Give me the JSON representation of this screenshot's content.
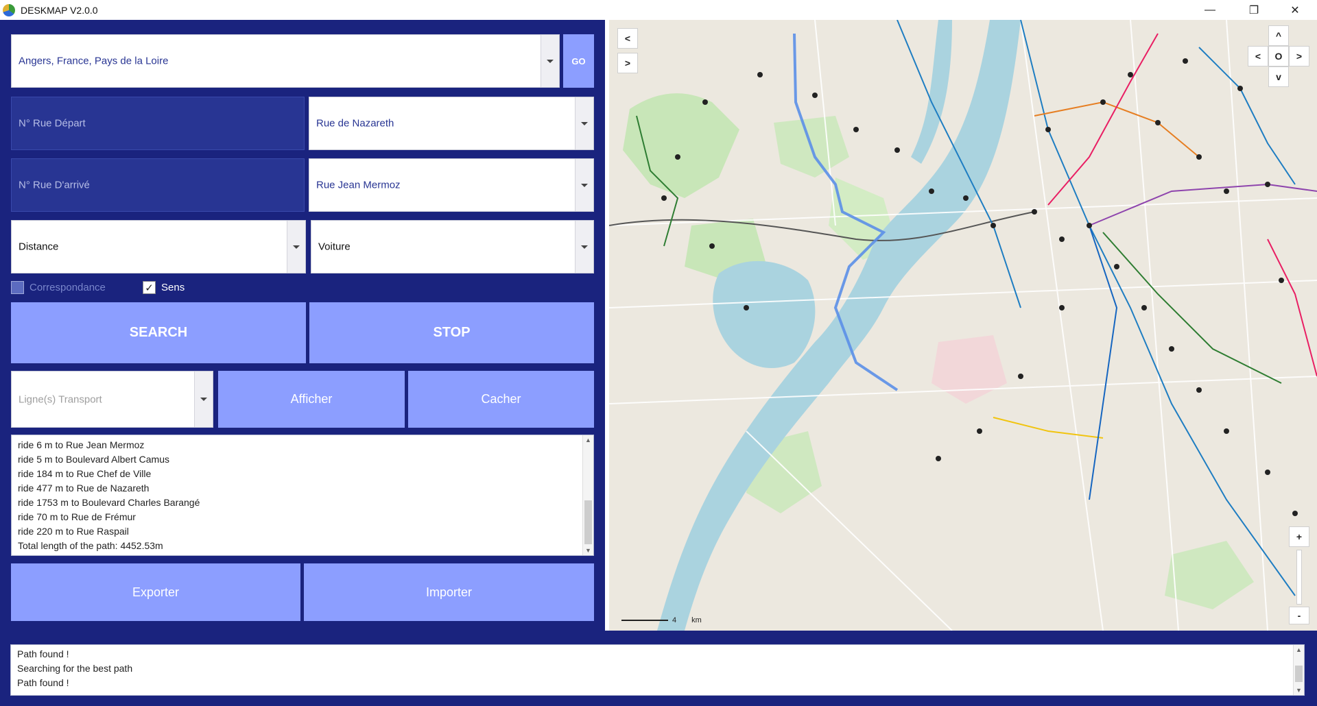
{
  "window": {
    "title": "DESKMAP V2.0.0",
    "minimize_icon": "—",
    "restore_icon": "❐",
    "close_icon": "✕"
  },
  "city_select": {
    "value": "Angers, France, Pays de la Loire"
  },
  "go_button": {
    "label": "GO"
  },
  "start": {
    "number_placeholder": "N° Rue Départ",
    "street_value": "Rue de Nazareth"
  },
  "end": {
    "number_placeholder": "N° Rue D'arrivé",
    "street_value": "Rue Jean Mermoz"
  },
  "criteria_select": {
    "value": "Distance"
  },
  "vehicle_select": {
    "value": "Voiture"
  },
  "options": {
    "correspondance": {
      "label": "Correspondance",
      "checked": false,
      "enabled": false
    },
    "sens": {
      "label": "Sens",
      "checked": true
    }
  },
  "actions": {
    "search_label": "SEARCH",
    "stop_label": "STOP"
  },
  "transport": {
    "lines_placeholder": "Ligne(s) Transport",
    "show_label": "Afficher",
    "hide_label": "Cacher"
  },
  "route_log": {
    "lines": [
      "ride 6 m to Rue Jean Mermoz",
      "ride 5 m to Boulevard Albert Camus",
      "ride 184 m to Rue Chef de Ville",
      "ride 477 m to Rue de Nazareth",
      "ride 1753 m to Boulevard Charles Barangé",
      "ride 70 m to Rue de Frémur",
      "ride 220 m to Rue Raspail",
      "Total length of the path: 4452.53m"
    ]
  },
  "file": {
    "export_label": "Exporter",
    "import_label": "Importer"
  },
  "map": {
    "nav_prev": "<",
    "nav_next": ">",
    "pan_up": "^",
    "pan_left": "<",
    "pan_center": "O",
    "pan_right": ">",
    "pan_down": "v",
    "zoom_in": "+",
    "zoom_out": "-",
    "scale_value": "4",
    "scale_unit": "km",
    "colors": {
      "river": "#aad3df",
      "park": "#c8e6b8",
      "route": "#5b8fe8"
    }
  },
  "status_log": {
    "lines": [
      "Path found !",
      "Searching for the best path",
      "Path found !"
    ]
  }
}
